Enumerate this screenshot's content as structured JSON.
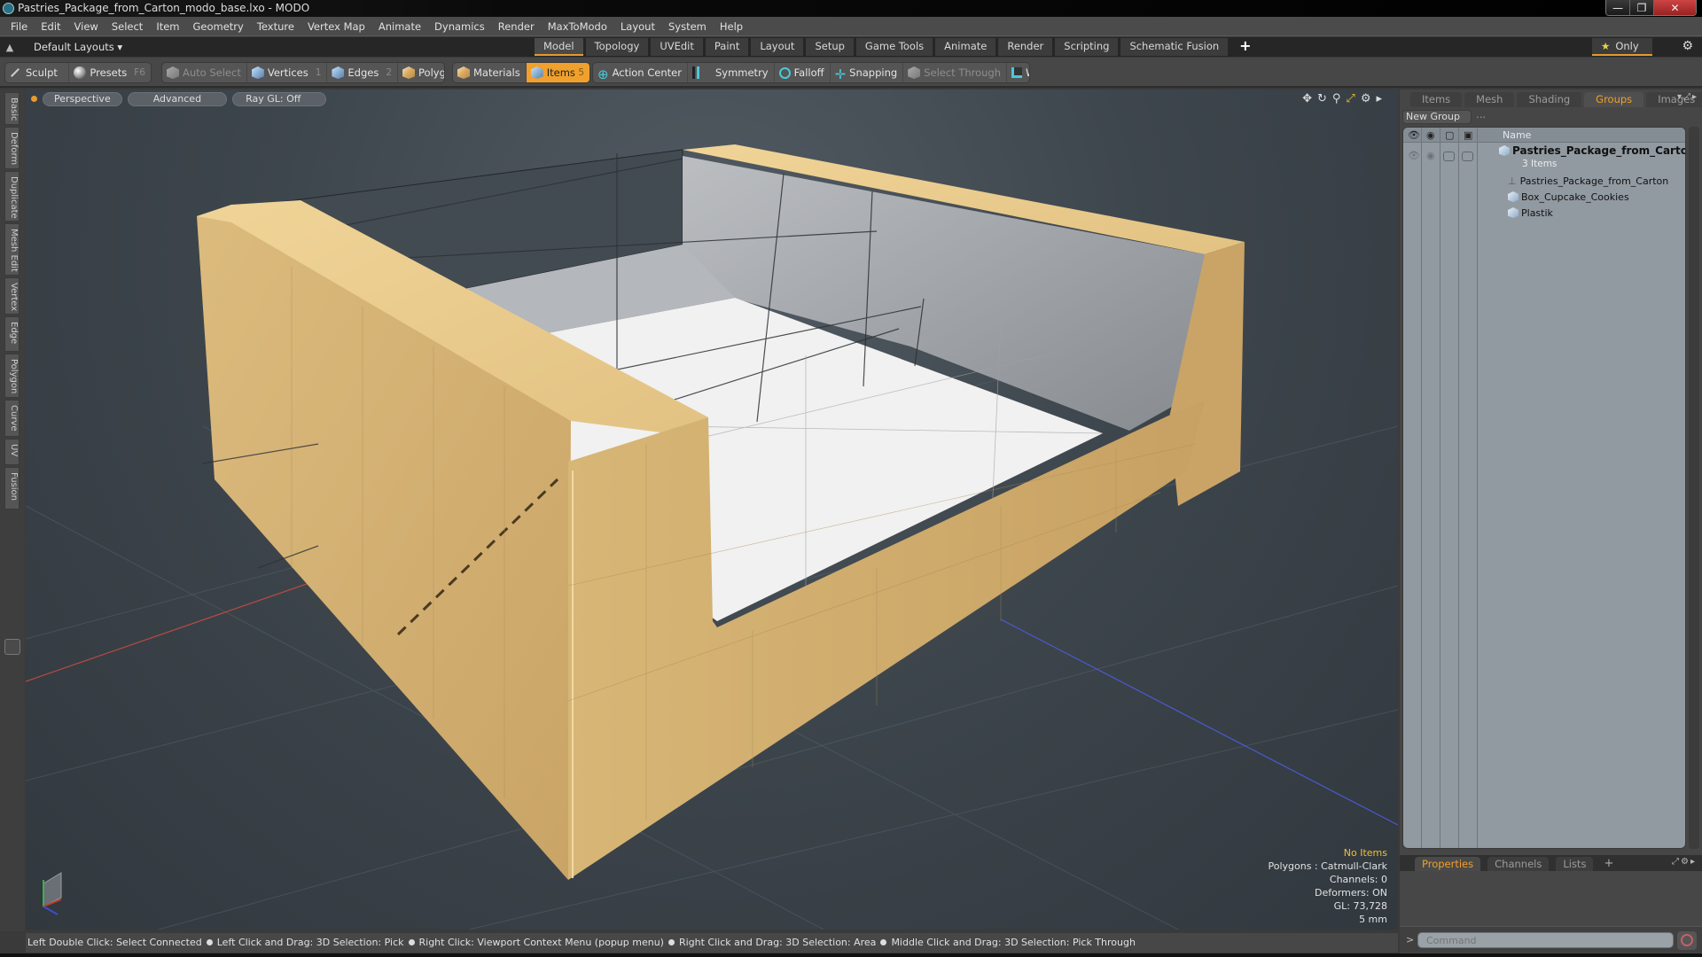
{
  "window": {
    "title": "Pastries_Package_from_Carton_modo_base.lxo - MODO",
    "buttons": {
      "minimize": "—",
      "restore": "❐",
      "close": "✕"
    }
  },
  "menu": [
    "File",
    "Edit",
    "View",
    "Select",
    "Item",
    "Geometry",
    "Texture",
    "Vertex Map",
    "Animate",
    "Dynamics",
    "Render",
    "MaxToModo",
    "Layout",
    "System",
    "Help"
  ],
  "layoutbar": {
    "layouts_label": "Default Layouts ▾",
    "mode_tabs": [
      {
        "label": "Model",
        "active": true
      },
      {
        "label": "Topology"
      },
      {
        "label": "UVEdit"
      },
      {
        "label": "Paint"
      },
      {
        "label": "Layout"
      },
      {
        "label": "Setup"
      },
      {
        "label": "Game Tools"
      },
      {
        "label": "Animate"
      },
      {
        "label": "Render"
      },
      {
        "label": "Scripting"
      },
      {
        "label": "Schematic Fusion"
      }
    ],
    "add_tab": "+",
    "only_label": "Only",
    "star": "★",
    "gear": "⚙"
  },
  "toolbar": {
    "sculpt": "Sculpt",
    "presets": "Presets",
    "presets_key": "F6",
    "auto_select": "Auto Select",
    "vertices": "Vertices",
    "vertices_key": "1",
    "edges": "Edges",
    "edges_key": "2",
    "polygons": "Polygons",
    "materials": "Materials",
    "items": "Items",
    "items_key": "5",
    "action_center": "Action Center",
    "symmetry": "Symmetry",
    "falloff": "Falloff",
    "snapping": "Snapping",
    "select_through": "Select Through",
    "workplane": "WorkPlane"
  },
  "left_tabs": [
    "Basic",
    "Deform",
    "Duplicate",
    "Mesh Edit",
    "Vertex",
    "Edge",
    "Polygon",
    "Curve",
    "UV",
    "Fusion"
  ],
  "viewport": {
    "view_mode": "Perspective",
    "shading": "Advanced",
    "raygl": "Ray GL: Off",
    "icons": [
      "move-icon",
      "rotate-icon",
      "zoom-icon",
      "maximize-icon",
      "settings-icon",
      "more-icon"
    ],
    "info": {
      "selection": "No Items",
      "polygons": "Polygons : Catmull-Clark",
      "channels": "Channels: 0",
      "deformers": "Deformers: ON",
      "gl": "GL: 73,728",
      "scale": "5 mm"
    },
    "colors": {
      "carton": "#d9b474",
      "carton_dark": "#c29a5c",
      "interior": "#f2f2f2",
      "window_film": "#aeb1b5",
      "x_axis": "#c0392b",
      "z_axis": "#3b4fd0"
    }
  },
  "status_bar": [
    "Left Double Click: Select Connected",
    "Left Click and Drag: 3D Selection: Pick",
    "Right Click: Viewport Context Menu (popup menu)",
    "Right Click and Drag: 3D Selection: Area",
    "Middle Click and Drag: 3D Selection: Pick Through"
  ],
  "right_panel": {
    "tabs": [
      {
        "label": "Items"
      },
      {
        "label": "Mesh ..."
      },
      {
        "label": "Shading"
      },
      {
        "label": "Groups",
        "active": true
      },
      {
        "label": "Images"
      }
    ],
    "new_group": "New Group",
    "column_name": "Name",
    "group": {
      "name": "Pastries_Package_from_Carton...",
      "count": "3 Items",
      "children": [
        "Pastries_Package_from_Carton",
        "Box_Cupcake_Cookies",
        "Plastik"
      ]
    },
    "bottom_tabs": [
      {
        "label": "Properties",
        "active": true
      },
      {
        "label": "Channels"
      },
      {
        "label": "Lists"
      }
    ],
    "add_tab": "+",
    "command_placeholder": "Command",
    "command_prompt": ">"
  }
}
